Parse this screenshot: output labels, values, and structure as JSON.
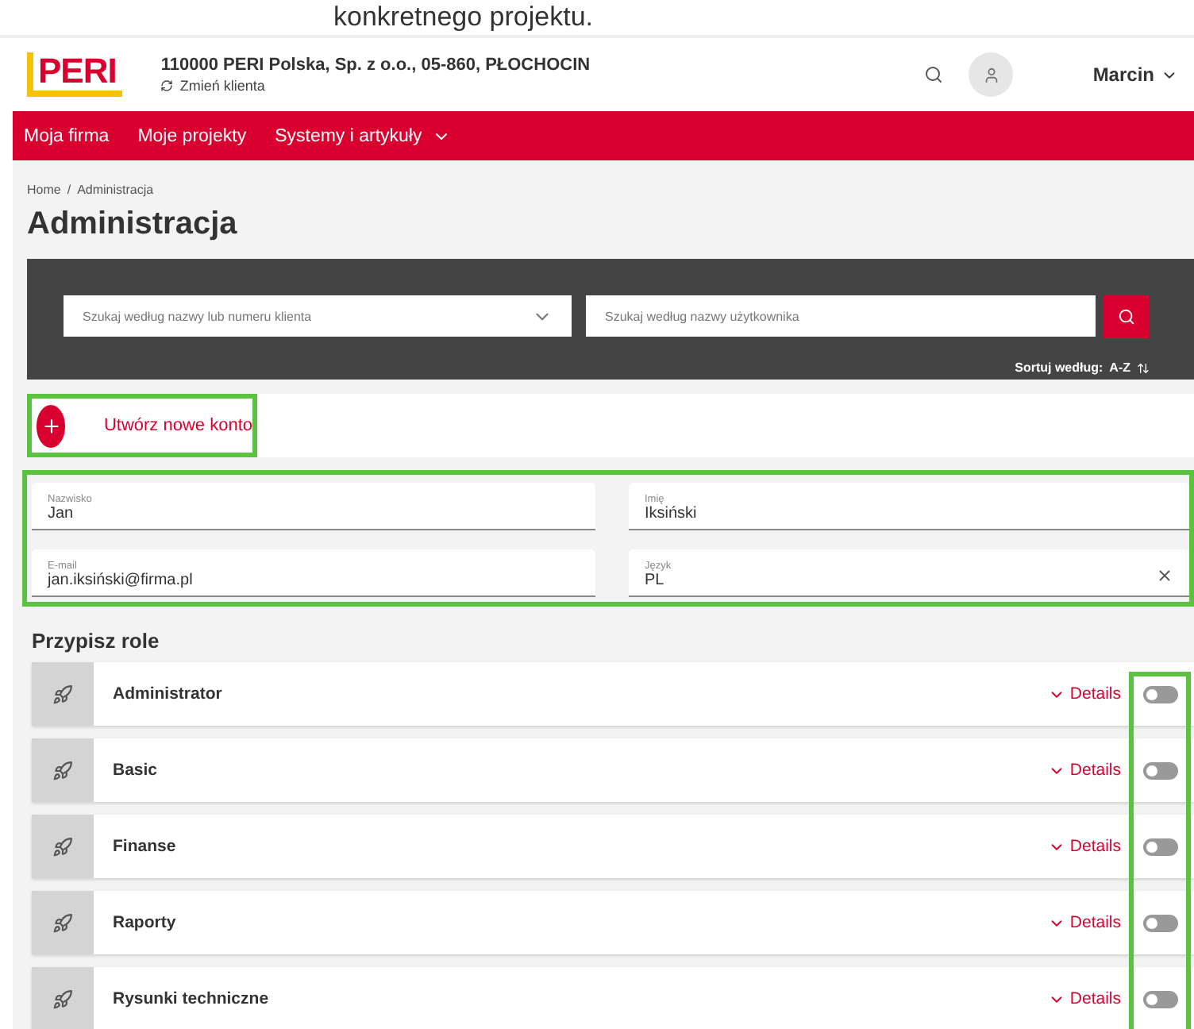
{
  "caption": "konkretnego projektu.",
  "header": {
    "company": "110000 PERI Polska, Sp. z o.o., 05-860, PŁOCHOCIN",
    "change_client": "Zmień klienta",
    "user": "Marcin"
  },
  "logo": "PERI",
  "nav": [
    "Moja firma",
    "Moje projekty",
    "Systemy i artykuły"
  ],
  "breadcrumb": [
    "Home",
    "Administracja"
  ],
  "breadcrumb_separator": "/",
  "title": "Administracja",
  "search": {
    "client_placeholder": "Szukaj według nazwy lub numeru klienta",
    "user_placeholder": "Szukaj według nazwy użytkownika",
    "sort_label": "Sortuj według:",
    "sort_value": "A-Z"
  },
  "create": "Utwórz nowe konto",
  "fields": [
    {
      "label": "Nazwisko",
      "value": "Jan",
      "clearable": false
    },
    {
      "label": "Imię",
      "value": "Iksiński",
      "clearable": false
    },
    {
      "label": "E-mail",
      "value": "jan.iksiński@firma.pl",
      "clearable": false
    },
    {
      "label": "Język",
      "value": "PL",
      "clearable": true
    }
  ],
  "roles_title": "Przypisz role",
  "roles": [
    {
      "name": "Administrator",
      "details": "Details",
      "on": false
    },
    {
      "name": "Basic",
      "details": "Details",
      "on": false
    },
    {
      "name": "Finanse",
      "details": "Details",
      "on": false
    },
    {
      "name": "Raporty",
      "details": "Details",
      "on": false
    },
    {
      "name": "Rysunki techniczne",
      "details": "Details",
      "on": false
    }
  ]
}
